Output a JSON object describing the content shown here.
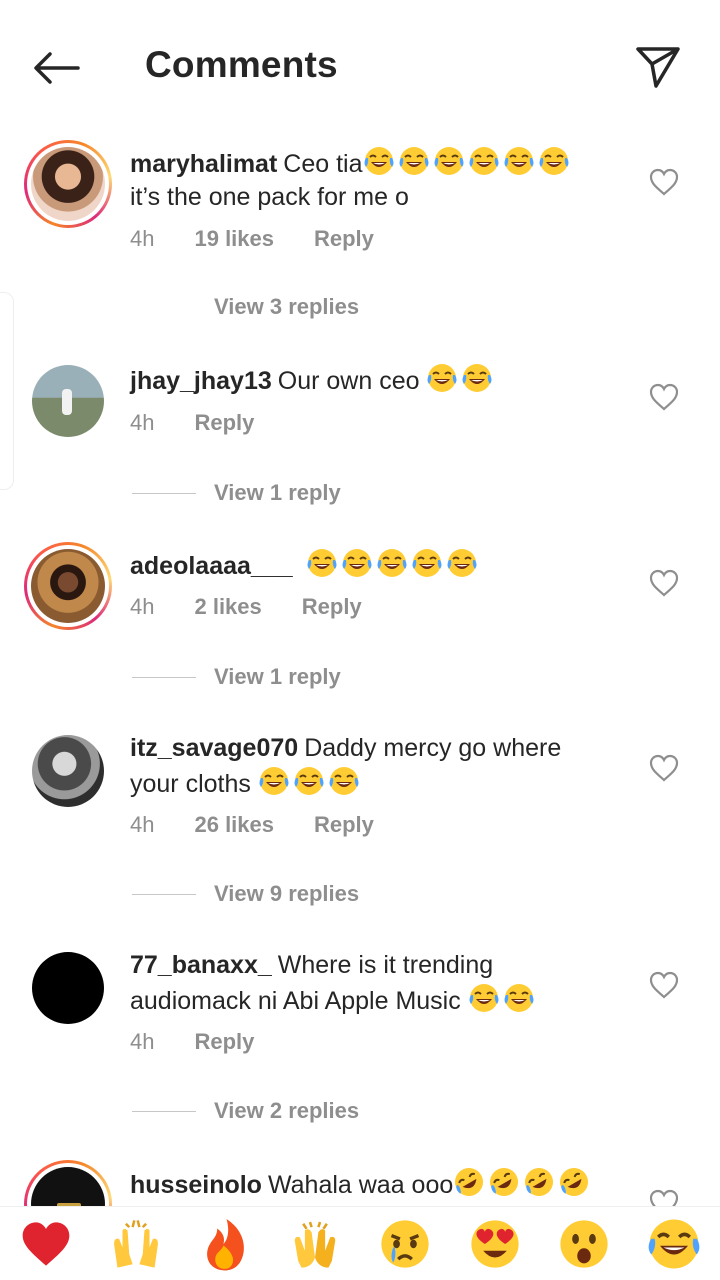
{
  "header": {
    "title": "Comments"
  },
  "comments": [
    {
      "username": "maryhalimat",
      "text_a": "Ceo tia",
      "text_b": "it’s the one pack for me o",
      "time": "4h",
      "likes": "19 likes",
      "reply": "Reply",
      "view_replies": "View 3 replies"
    },
    {
      "username": "jhay_jhay13",
      "text_a": "Our own ceo",
      "time": "4h",
      "reply": "Reply",
      "view_replies": "View 1 reply"
    },
    {
      "username": "adeolaaaa___",
      "time": "4h",
      "likes": "2 likes",
      "reply": "Reply",
      "view_replies": "View 1 reply"
    },
    {
      "username": "itz_savage070",
      "text_a": "Daddy mercy go where your cloths",
      "time": "4h",
      "likes": "26 likes",
      "reply": "Reply",
      "view_replies": "View 9 replies"
    },
    {
      "username": "77_banaxx_",
      "text_a": "Where is it trending audiomack ni Abi Apple Music",
      "time": "4h",
      "reply": "Reply",
      "view_replies": "View 2 replies"
    },
    {
      "username": "husseinolo",
      "text_a": "Wahala waa ooo"
    }
  ],
  "reactions": [
    "red-heart",
    "raising-hands",
    "fire",
    "clapping-hands",
    "crying-face",
    "heart-eyes",
    "astonished-face",
    "tears-of-joy"
  ],
  "colors": {
    "text": "#262626",
    "secondary": "#8e8e8e",
    "heart": "#ed4956",
    "story_ring_start": "#f58529",
    "story_ring_end": "#dd2a7b"
  }
}
